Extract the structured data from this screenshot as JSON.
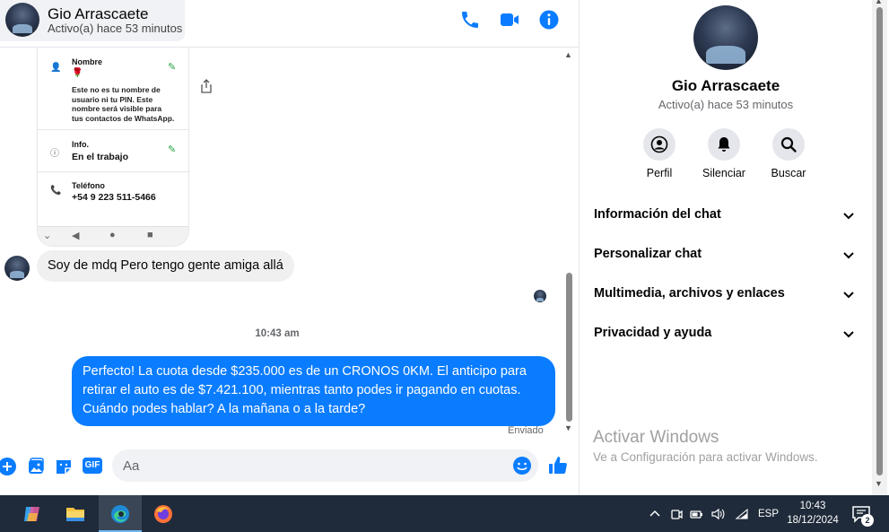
{
  "header": {
    "contact_name": "Gio Arrascaete",
    "status": "Activo(a) hace 53 minutos"
  },
  "phone_screenshot": {
    "name_label": "Nombre",
    "name_emoji": "🌹",
    "name_description": "Este no es tu nombre de usuario ni tu PIN. Este nombre será visible para tus contactos de WhatsApp.",
    "info_label": "Info.",
    "info_value": "En el trabajo",
    "phone_label": "Teléfono",
    "phone_value": "+54 9 223 511-5466"
  },
  "messages": {
    "incoming_text": "Soy de mdq Pero tengo gente amiga allá",
    "timestamp": "10:43 am",
    "outgoing_text": "Perfecto! La cuota desde $235.000 es de un CRONOS 0KM. El anticipo para retirar el auto es de $7.421.100, mientras tanto podes ir pagando en cuotas. Cuándo podes hablar? A la mañana o a la tarde?",
    "sent_label": "Enviado"
  },
  "composer": {
    "placeholder": "Aa",
    "gif_label": "GIF"
  },
  "right_panel": {
    "name": "Gio Arrascaete",
    "status": "Activo(a) hace 53 minutos",
    "actions": [
      {
        "label": "Perfil",
        "icon": "profile-icon"
      },
      {
        "label": "Silenciar",
        "icon": "bell-icon"
      },
      {
        "label": "Buscar",
        "icon": "search-icon"
      }
    ],
    "sections": [
      {
        "title": "Información del chat"
      },
      {
        "title": "Personalizar chat"
      },
      {
        "title": "Multimedia, archivos y enlaces"
      },
      {
        "title": "Privacidad y ayuda"
      }
    ],
    "watermark_title": "Activar Windows",
    "watermark_sub": "Ve a Configuración para activar Windows."
  },
  "taskbar": {
    "language": "ESP",
    "time": "10:43",
    "date": "18/12/2024",
    "notification_count": "2"
  },
  "colors": {
    "accent": "#0a7cff",
    "bubble_in": "#f0f0f0",
    "taskbar": "#1f2b3a"
  }
}
